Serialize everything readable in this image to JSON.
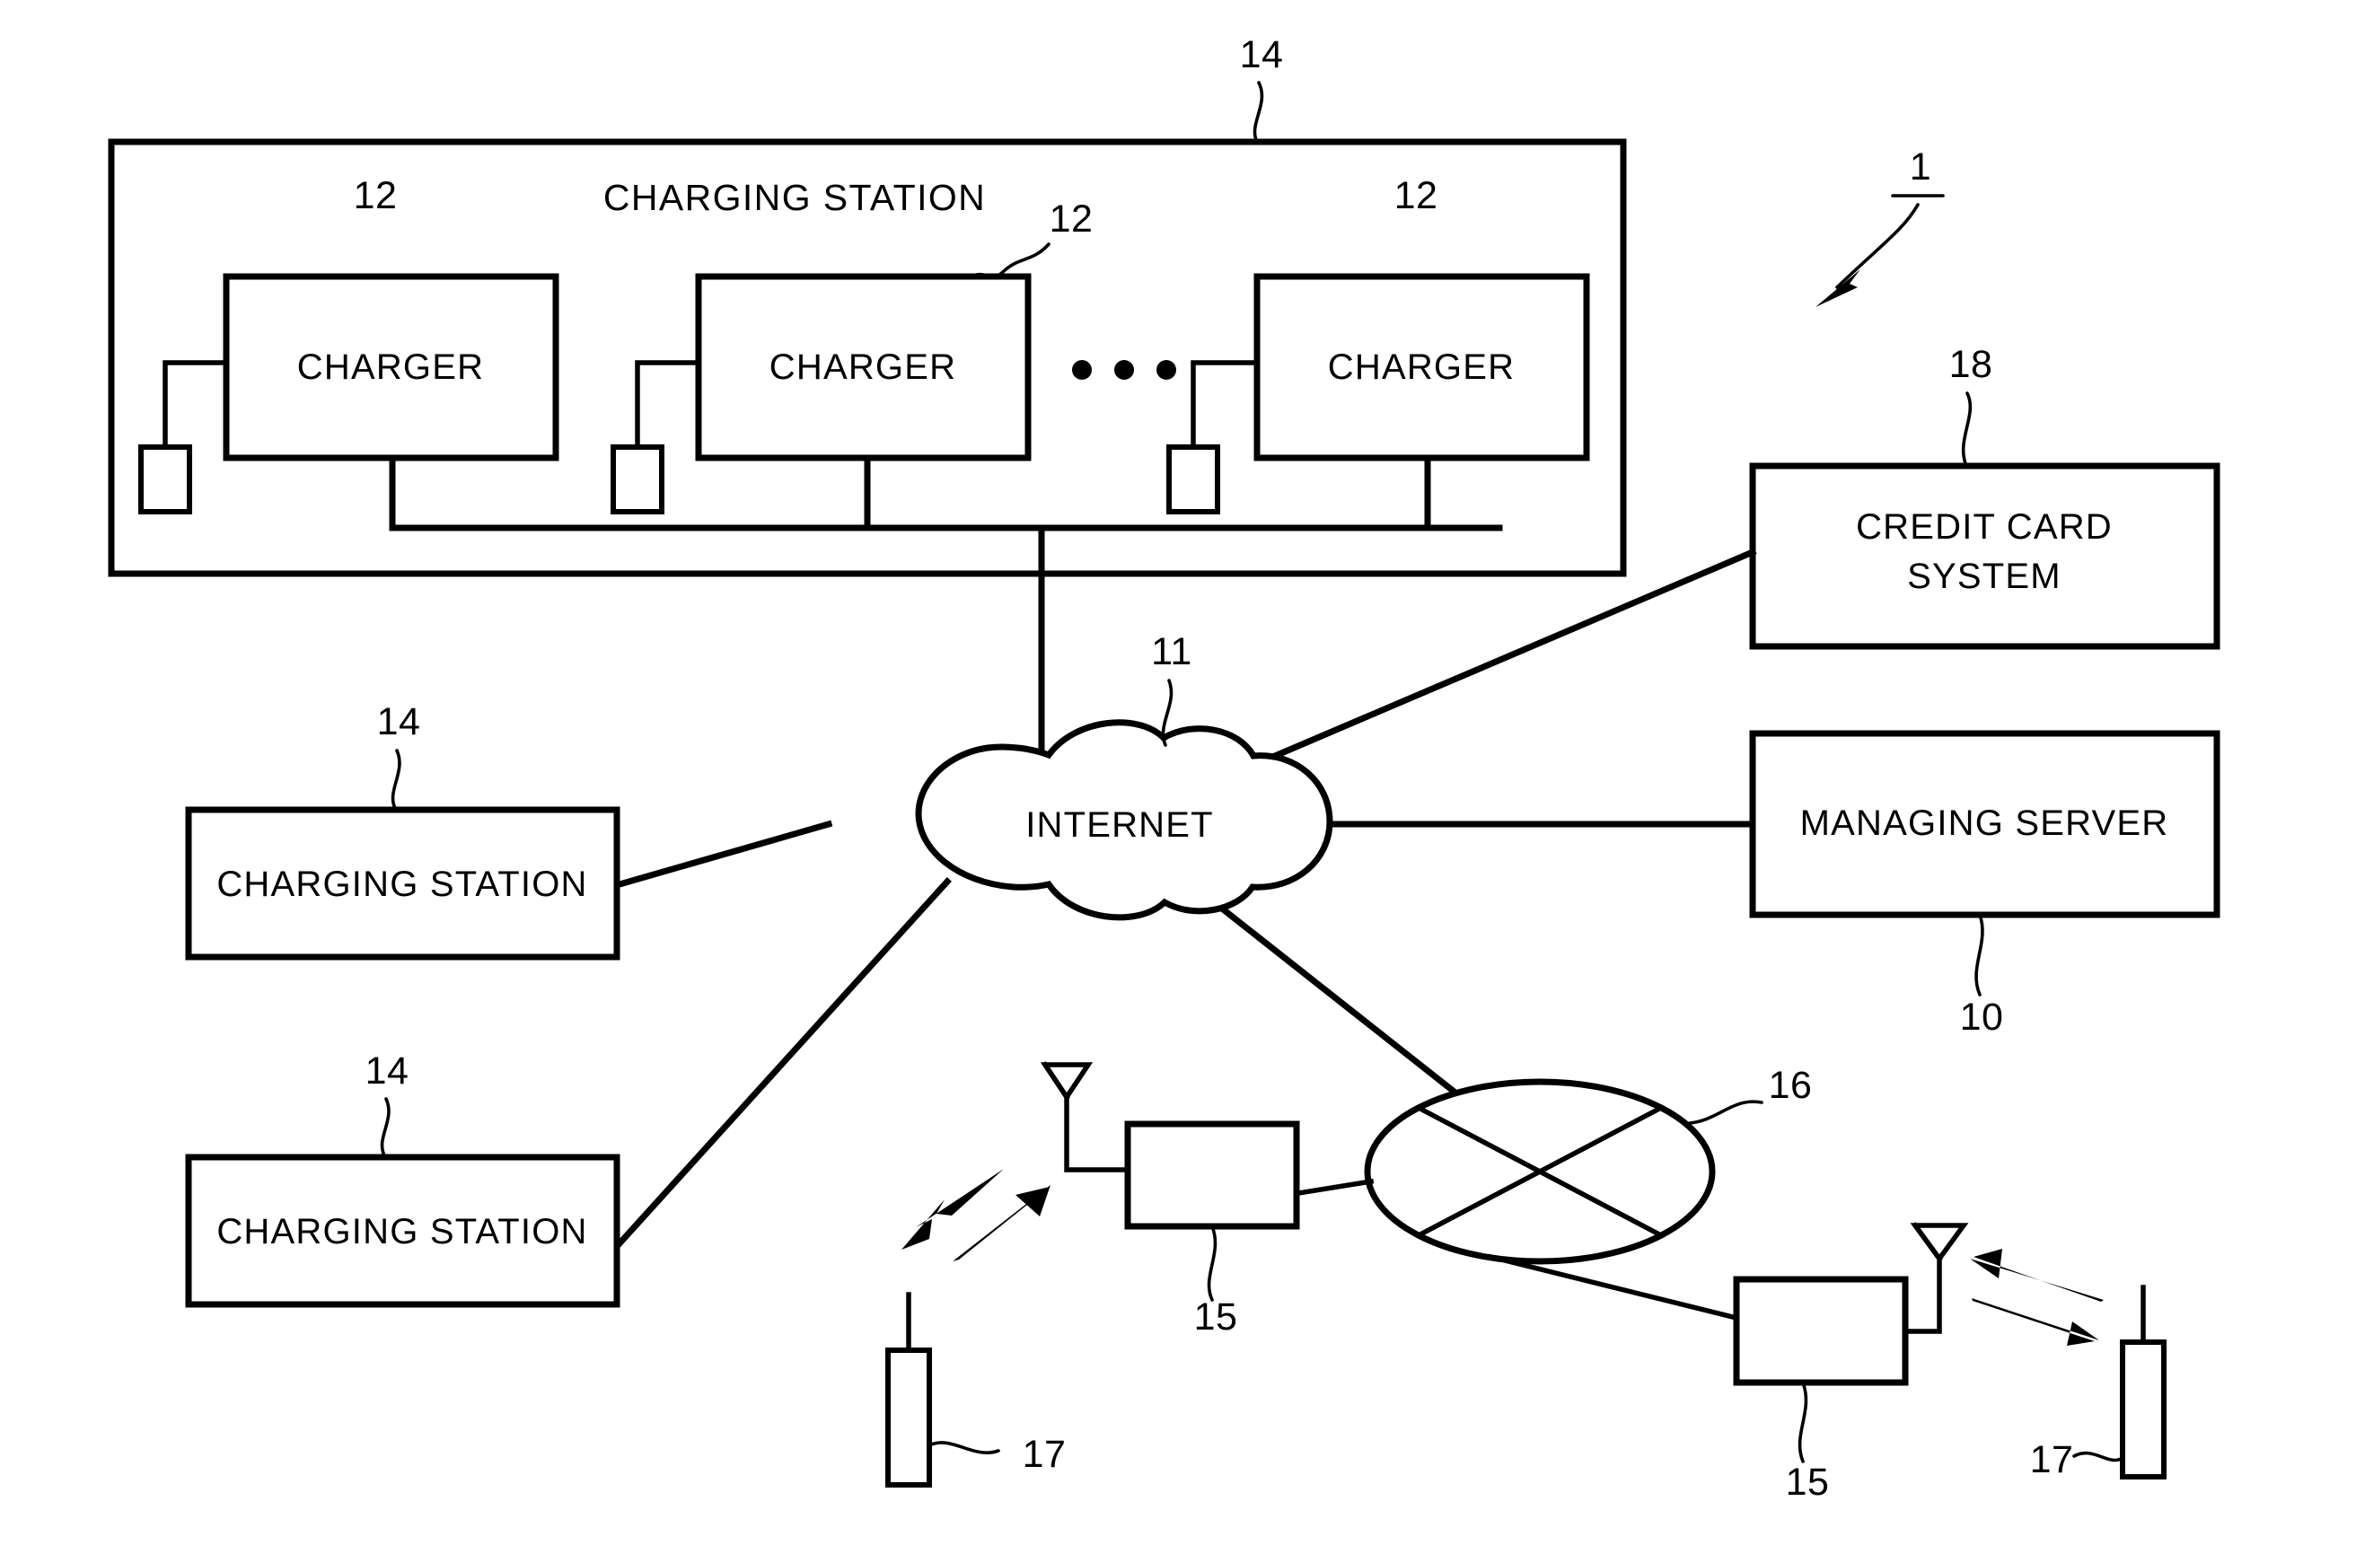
{
  "figure": {
    "kind": "patent-system-diagram",
    "background_color": "#ffffff",
    "line_color": "#000000"
  },
  "main_station": {
    "title": "CHARGING STATION",
    "frame_ref": "14",
    "chargers": [
      {
        "label": "CHARGER",
        "ref": "12"
      },
      {
        "label": "CHARGER",
        "ref": "12"
      },
      {
        "label": "CHARGER",
        "ref": "12"
      }
    ],
    "ellipsis": "• • •"
  },
  "network": {
    "cloud_label": "INTERNET",
    "cloud_ref": "11",
    "wireless_core_ref": "16"
  },
  "right_nodes": [
    {
      "line1": "CREDIT CARD",
      "line2": "SYSTEM",
      "ref": "18"
    },
    {
      "line1": "MANAGING SERVER",
      "line2": "",
      "ref": "10"
    }
  ],
  "left_stations": [
    {
      "label": "CHARGING STATION",
      "ref": "14"
    },
    {
      "label": "CHARGING STATION",
      "ref": "14"
    }
  ],
  "base_stations": [
    {
      "ref": "15",
      "side": "left"
    },
    {
      "ref": "15",
      "side": "right"
    }
  ],
  "mobile_terminals": [
    {
      "ref": "17",
      "side": "left"
    },
    {
      "ref": "17",
      "side": "right"
    }
  ],
  "system_ref": "1"
}
